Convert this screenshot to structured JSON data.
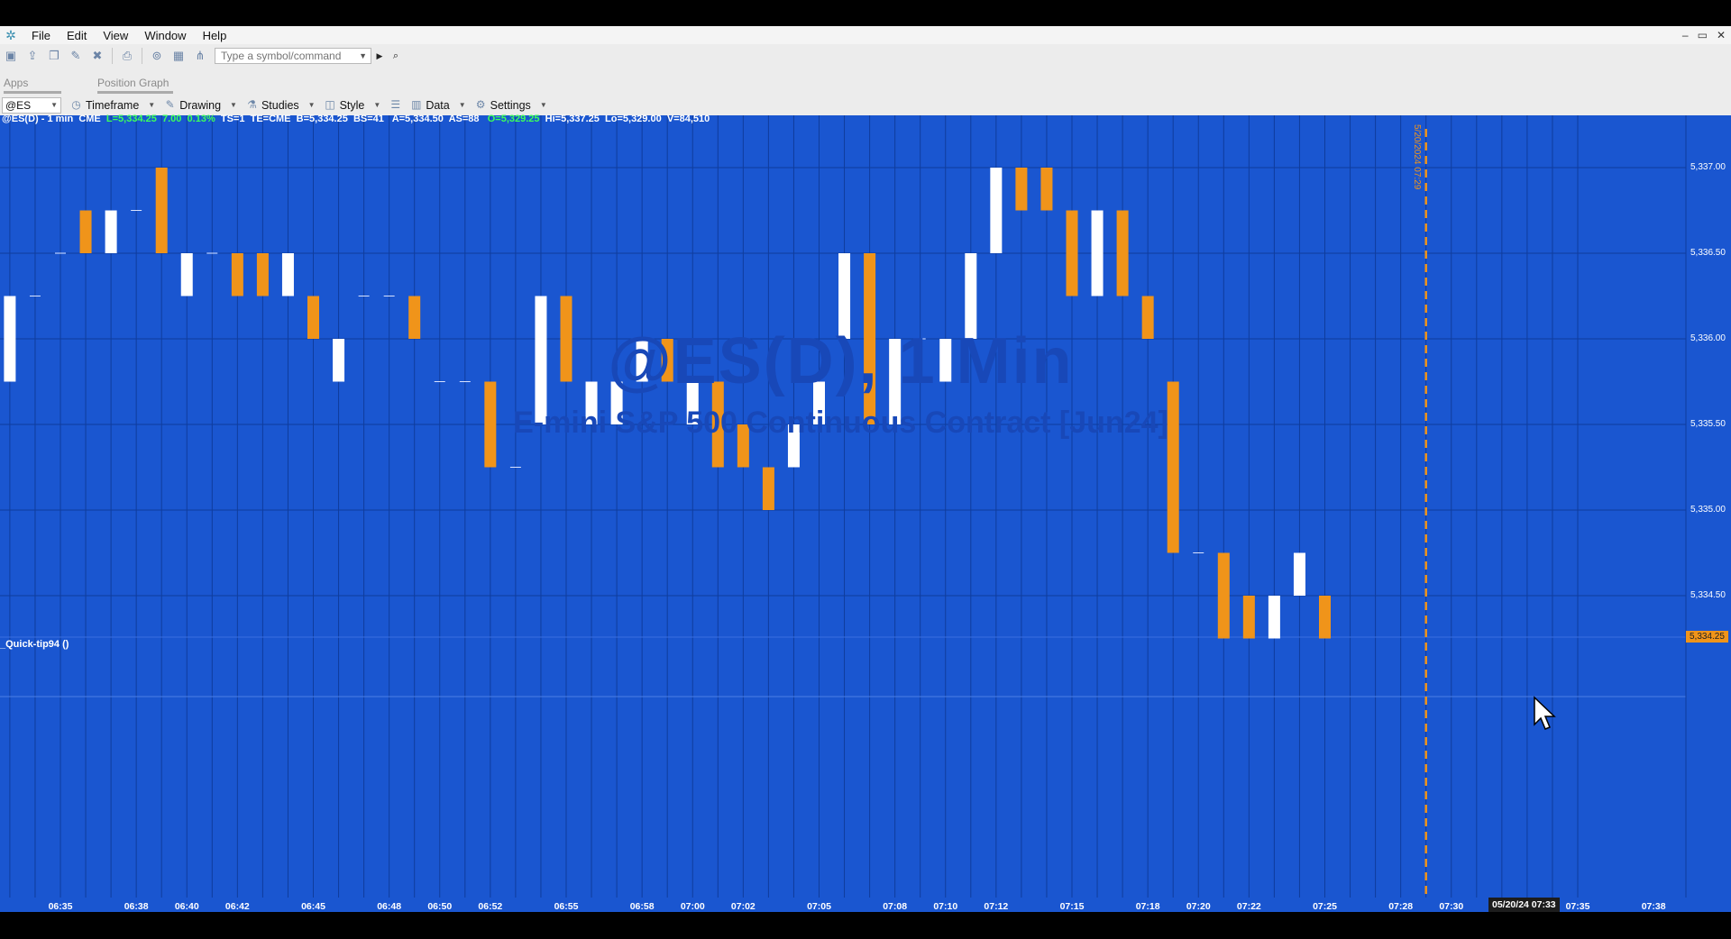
{
  "menu": [
    "File",
    "Edit",
    "View",
    "Window",
    "Help"
  ],
  "window_controls": [
    "–",
    "▭",
    "✕"
  ],
  "toolbar": {
    "symbol_placeholder": "Type a symbol/command"
  },
  "tabs": {
    "apps": "Apps",
    "position_graph": "Position Graph"
  },
  "chart_toolbar": {
    "symbol": "@ES",
    "timeframe": "Timeframe",
    "drawing": "Drawing",
    "studies": "Studies",
    "style": "Style",
    "data": "Data",
    "settings": "Settings"
  },
  "info": {
    "symbol": "@ES(D) - 1 min",
    "exchange": "CME",
    "last": "L=5,334.25",
    "change": "7.00",
    "pct": "0.13%",
    "ts": "TS=1",
    "te": "TE=CME",
    "bid": "B=5,334.25",
    "bs": "BS=41",
    "ask": "A=5,334.50",
    "as": "AS=88",
    "open": "O=5,329.25",
    "high": "Hi=5,337.25",
    "low": "Lo=5,329.00",
    "vol": "V=84,510"
  },
  "watermark": {
    "line1": "@ES(D), 1 Min",
    "line2": "E-mini S&P 500 Continuous Contract [Jun24]"
  },
  "subpanel": "_Quick-tip94 ()",
  "vline_label": "5/20/2024 07:29",
  "last_price_label": "5,334.25",
  "time_highlight": "05/20/24 07:33",
  "colors": {
    "background": "#1a56d0",
    "up": "#ffffff",
    "down": "#f0941a",
    "grid": "#0f3c9c"
  },
  "chart_data": {
    "type": "candlestick",
    "ylim": [
      5334.25,
      5337.25
    ],
    "y_ticks": [
      "5,337.00",
      "5,336.50",
      "5,336.00",
      "5,335.50",
      "5,335.00",
      "5,334.50"
    ],
    "x_ticks": [
      "06:35",
      "06:38",
      "06:40",
      "06:42",
      "06:45",
      "06:48",
      "06:50",
      "06:52",
      "06:55",
      "06:58",
      "07:00",
      "07:02",
      "07:05",
      "07:08",
      "07:10",
      "07:12",
      "07:15",
      "07:18",
      "07:20",
      "07:22",
      "07:25",
      "07:28",
      "07:30",
      "07:35",
      "07:38"
    ],
    "bars": [
      {
        "t": "06:33",
        "o": 5335.75,
        "c": 5336.25,
        "h": 5336.25,
        "l": 5335.75
      },
      {
        "t": "06:34",
        "o": 5336.25,
        "c": 5336.25,
        "h": 5336.25,
        "l": 5336.25
      },
      {
        "t": "06:35",
        "o": 5336.5,
        "c": 5336.5,
        "h": 5336.5,
        "l": 5336.5
      },
      {
        "t": "06:36",
        "o": 5336.75,
        "c": 5336.5,
        "h": 5336.75,
        "l": 5336.5
      },
      {
        "t": "06:37",
        "o": 5336.5,
        "c": 5336.75,
        "h": 5336.75,
        "l": 5336.5
      },
      {
        "t": "06:38",
        "o": 5336.75,
        "c": 5336.75,
        "h": 5336.75,
        "l": 5336.75
      },
      {
        "t": "06:39",
        "o": 5337.0,
        "c": 5336.5,
        "h": 5337.0,
        "l": 5336.5
      },
      {
        "t": "06:40",
        "o": 5336.25,
        "c": 5336.5,
        "h": 5336.5,
        "l": 5336.25
      },
      {
        "t": "06:41",
        "o": 5336.5,
        "c": 5336.5,
        "h": 5336.5,
        "l": 5336.5
      },
      {
        "t": "06:42",
        "o": 5336.5,
        "c": 5336.25,
        "h": 5336.5,
        "l": 5336.25
      },
      {
        "t": "06:43",
        "o": 5336.5,
        "c": 5336.25,
        "h": 5336.5,
        "l": 5336.25
      },
      {
        "t": "06:44",
        "o": 5336.25,
        "c": 5336.5,
        "h": 5336.5,
        "l": 5336.25
      },
      {
        "t": "06:45",
        "o": 5336.25,
        "c": 5336.0,
        "h": 5336.25,
        "l": 5336.0
      },
      {
        "t": "06:46",
        "o": 5335.75,
        "c": 5336.0,
        "h": 5336.0,
        "l": 5335.75
      },
      {
        "t": "06:47",
        "o": 5336.25,
        "c": 5336.25,
        "h": 5336.25,
        "l": 5336.25
      },
      {
        "t": "06:48",
        "o": 5336.25,
        "c": 5336.25,
        "h": 5336.25,
        "l": 5336.25
      },
      {
        "t": "06:49",
        "o": 5336.25,
        "c": 5336.0,
        "h": 5336.25,
        "l": 5336.0
      },
      {
        "t": "06:50",
        "o": 5335.75,
        "c": 5335.75,
        "h": 5335.75,
        "l": 5335.75
      },
      {
        "t": "06:51",
        "o": 5335.75,
        "c": 5335.75,
        "h": 5335.75,
        "l": 5335.75
      },
      {
        "t": "06:52",
        "o": 5335.75,
        "c": 5335.25,
        "h": 5335.75,
        "l": 5335.25
      },
      {
        "t": "06:53",
        "o": 5335.25,
        "c": 5335.25,
        "h": 5335.25,
        "l": 5335.25
      },
      {
        "t": "06:54",
        "o": 5335.5,
        "c": 5336.25,
        "h": 5336.25,
        "l": 5335.5
      },
      {
        "t": "06:55",
        "o": 5336.25,
        "c": 5335.75,
        "h": 5336.25,
        "l": 5335.75
      },
      {
        "t": "06:56",
        "o": 5335.5,
        "c": 5335.75,
        "h": 5335.75,
        "l": 5335.5
      },
      {
        "t": "06:57",
        "o": 5335.5,
        "c": 5335.75,
        "h": 5335.75,
        "l": 5335.5
      },
      {
        "t": "06:58",
        "o": 5335.75,
        "c": 5336.0,
        "h": 5336.0,
        "l": 5335.75
      },
      {
        "t": "06:59",
        "o": 5336.0,
        "c": 5335.75,
        "h": 5336.0,
        "l": 5335.75
      },
      {
        "t": "07:00",
        "o": 5335.5,
        "c": 5335.75,
        "h": 5335.75,
        "l": 5335.5
      },
      {
        "t": "07:01",
        "o": 5335.75,
        "c": 5335.25,
        "h": 5335.75,
        "l": 5335.25
      },
      {
        "t": "07:02",
        "o": 5335.5,
        "c": 5335.25,
        "h": 5335.5,
        "l": 5335.25
      },
      {
        "t": "07:03",
        "o": 5335.25,
        "c": 5335.0,
        "h": 5335.25,
        "l": 5335.0
      },
      {
        "t": "07:04",
        "o": 5335.25,
        "c": 5335.5,
        "h": 5335.5,
        "l": 5335.25
      },
      {
        "t": "07:05",
        "o": 5335.5,
        "c": 5335.75,
        "h": 5335.75,
        "l": 5335.5
      },
      {
        "t": "07:06",
        "o": 5336.0,
        "c": 5336.5,
        "h": 5336.5,
        "l": 5336.0
      },
      {
        "t": "07:07",
        "o": 5336.5,
        "c": 5335.5,
        "h": 5336.5,
        "l": 5335.5
      },
      {
        "t": "07:08",
        "o": 5335.5,
        "c": 5336.0,
        "h": 5336.0,
        "l": 5335.5
      },
      {
        "t": "07:09",
        "o": 5336.0,
        "c": 5336.0,
        "h": 5336.0,
        "l": 5336.0
      },
      {
        "t": "07:10",
        "o": 5335.75,
        "c": 5336.0,
        "h": 5336.0,
        "l": 5335.75
      },
      {
        "t": "07:11",
        "o": 5336.0,
        "c": 5336.5,
        "h": 5336.5,
        "l": 5336.0
      },
      {
        "t": "07:12",
        "o": 5336.5,
        "c": 5337.0,
        "h": 5337.0,
        "l": 5336.5
      },
      {
        "t": "07:13",
        "o": 5337.0,
        "c": 5336.75,
        "h": 5337.0,
        "l": 5336.75
      },
      {
        "t": "07:14",
        "o": 5337.0,
        "c": 5336.75,
        "h": 5337.0,
        "l": 5336.75
      },
      {
        "t": "07:15",
        "o": 5336.75,
        "c": 5336.25,
        "h": 5336.75,
        "l": 5336.25
      },
      {
        "t": "07:16",
        "o": 5336.25,
        "c": 5336.75,
        "h": 5336.75,
        "l": 5336.25
      },
      {
        "t": "07:17",
        "o": 5336.75,
        "c": 5336.25,
        "h": 5336.75,
        "l": 5336.25
      },
      {
        "t": "07:18",
        "o": 5336.25,
        "c": 5336.0,
        "h": 5336.25,
        "l": 5336.0
      },
      {
        "t": "07:19",
        "o": 5335.75,
        "c": 5334.75,
        "h": 5335.75,
        "l": 5334.75
      },
      {
        "t": "07:20",
        "o": 5334.75,
        "c": 5334.75,
        "h": 5334.75,
        "l": 5334.75
      },
      {
        "t": "07:21",
        "o": 5334.75,
        "c": 5334.25,
        "h": 5334.75,
        "l": 5334.25
      },
      {
        "t": "07:22",
        "o": 5334.5,
        "c": 5334.25,
        "h": 5334.5,
        "l": 5334.25
      },
      {
        "t": "07:23",
        "o": 5334.25,
        "c": 5334.5,
        "h": 5334.5,
        "l": 5334.25
      },
      {
        "t": "07:24",
        "o": 5334.5,
        "c": 5334.75,
        "h": 5334.75,
        "l": 5334.5
      },
      {
        "t": "07:25",
        "o": 5334.5,
        "c": 5334.25,
        "h": 5334.5,
        "l": 5334.25
      }
    ]
  }
}
